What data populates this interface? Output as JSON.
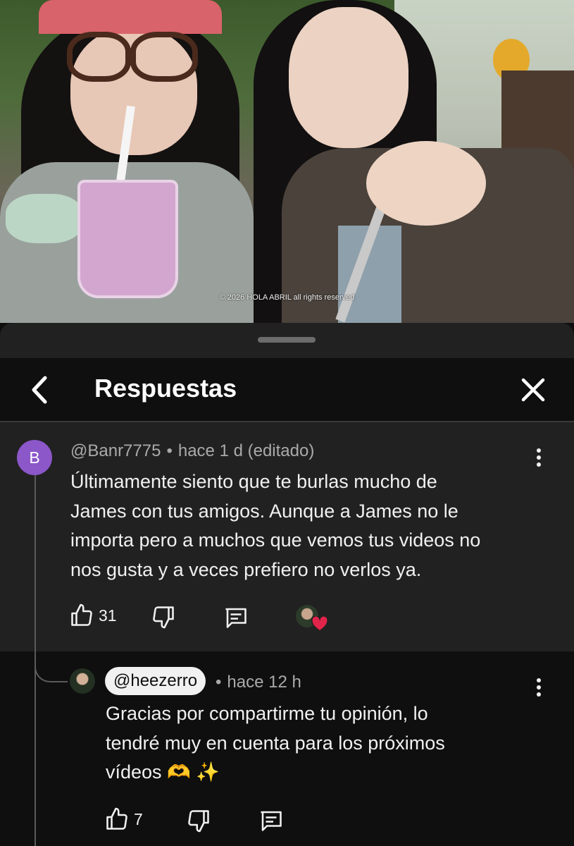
{
  "video": {
    "watermark": "© 2026 HOLA ABRIL all rights reserved"
  },
  "header": {
    "title": "Respuestas",
    "back_icon": "chevron-left-icon",
    "close_icon": "close-icon"
  },
  "comment": {
    "avatar_letter": "B",
    "author": "@Banr7775",
    "separator": "•",
    "time": "hace 1 d (editado)",
    "text_lines": [
      "Últimamente siento que te burlas mucho de",
      "James con tus amigos. Aunque a James no le",
      "importa pero a muchos que vemos tus videos no",
      "nos gusta y a veces prefiero no verlos ya."
    ],
    "likes": "31"
  },
  "reply": {
    "author": "@heezerro",
    "separator": "•",
    "time": "hace 12 h",
    "text_lines": [
      "Gracias por compartirme tu opinión, lo",
      "tendré muy en cuenta para los próximos",
      "vídeos 🫶 ✨"
    ],
    "likes": "7"
  },
  "colors": {
    "sheet_bg": "#212121",
    "header_bg": "#0f0f0f",
    "avatar_b": "#8b57c9",
    "heart": "#e0244a"
  }
}
